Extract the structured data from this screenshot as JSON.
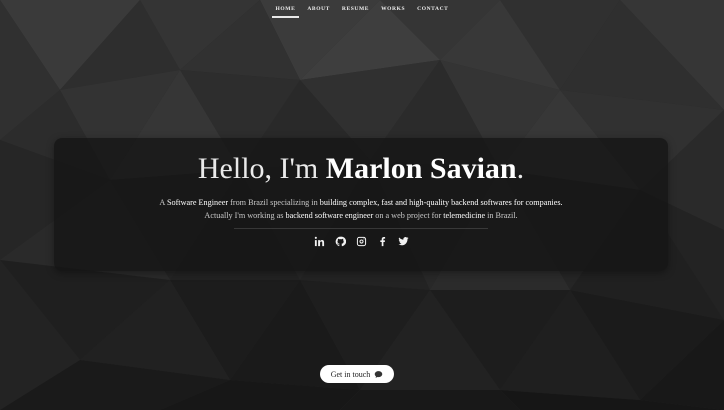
{
  "nav": {
    "items": [
      {
        "label": "HOME",
        "active": true
      },
      {
        "label": "ABOUT"
      },
      {
        "label": "RESUME"
      },
      {
        "label": "WORKS"
      },
      {
        "label": "CONTACT"
      }
    ]
  },
  "hero": {
    "greeting": "Hello, I'm",
    "name": "Marlon Savian",
    "period": ".",
    "line1": {
      "a": "A ",
      "b": "Software Engineer",
      "c": " from Brazil specializing in ",
      "d": "building complex, fast and high-quality backend softwares for companies."
    },
    "line2": {
      "a": "Actually I'm working as ",
      "b": "backend software engineer",
      "c": " on a web project for ",
      "d": "telemedicine",
      "e": " in Brazil."
    },
    "socials": [
      {
        "icon": "linkedin-icon"
      },
      {
        "icon": "github-icon"
      },
      {
        "icon": "instagram-icon"
      },
      {
        "icon": "facebook-icon"
      },
      {
        "icon": "twitter-icon"
      }
    ]
  },
  "cta": {
    "label": "Get in touch",
    "icon": "speech-bubble-icon"
  },
  "colors": {
    "background": "#2a2a2a",
    "card": "#141414",
    "accent": "#ffffff"
  }
}
